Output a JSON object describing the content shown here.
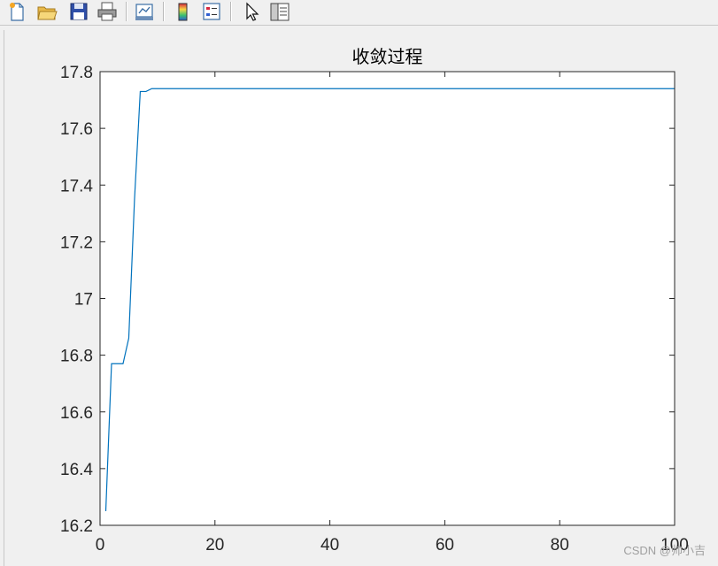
{
  "toolbar": {
    "buttons": [
      {
        "name": "new-figure-icon"
      },
      {
        "name": "open-file-icon"
      },
      {
        "name": "save-figure-icon"
      },
      {
        "name": "print-figure-icon"
      },
      {
        "name": "link-plot-icon"
      },
      {
        "name": "insert-colorbar-icon"
      },
      {
        "name": "insert-legend-icon"
      },
      {
        "name": "edit-plot-cursor-icon"
      },
      {
        "name": "property-inspector-icon"
      }
    ]
  },
  "colors": {
    "line": "#0072bd",
    "axes_background": "#ffffff",
    "figure_background": "#f0f0f0",
    "axis": "#262626"
  },
  "watermark": "CSDN @帅小吉",
  "chart_data": {
    "type": "line",
    "title": "收敛过程",
    "xlabel": "",
    "ylabel": "",
    "xlim": [
      0,
      100
    ],
    "ylim": [
      16.2,
      17.8
    ],
    "xticks": [
      0,
      20,
      40,
      60,
      80,
      100
    ],
    "xtick_labels": [
      "0",
      "20",
      "40",
      "60",
      "80",
      "100"
    ],
    "yticks": [
      16.2,
      16.4,
      16.6,
      16.8,
      17.0,
      17.2,
      17.4,
      17.6,
      17.8
    ],
    "ytick_labels": [
      "16.2",
      "16.4",
      "16.6",
      "16.8",
      "17",
      "17.2",
      "17.4",
      "17.6",
      "17.8"
    ],
    "grid": false,
    "box": true,
    "series": [
      {
        "x": [
          1,
          2,
          3,
          4,
          5,
          6,
          7,
          8,
          9,
          10,
          11,
          12,
          13,
          14,
          15,
          16,
          17,
          18,
          19,
          20,
          21,
          22,
          23,
          24,
          25,
          26,
          27,
          28,
          29,
          30,
          31,
          32,
          33,
          34,
          35,
          36,
          37,
          38,
          39,
          40,
          41,
          42,
          43,
          44,
          45,
          46,
          47,
          48,
          49,
          50,
          51,
          52,
          53,
          54,
          55,
          56,
          57,
          58,
          59,
          60,
          61,
          62,
          63,
          64,
          65,
          66,
          67,
          68,
          69,
          70,
          71,
          72,
          73,
          74,
          75,
          76,
          77,
          78,
          79,
          80,
          81,
          82,
          83,
          84,
          85,
          86,
          87,
          88,
          89,
          90,
          91,
          92,
          93,
          94,
          95,
          96,
          97,
          98,
          99,
          100
        ],
        "values": [
          16.25,
          16.77,
          16.77,
          16.77,
          16.86,
          17.35,
          17.73,
          17.73,
          17.74,
          17.74,
          17.74,
          17.74,
          17.74,
          17.74,
          17.74,
          17.74,
          17.74,
          17.74,
          17.74,
          17.74,
          17.74,
          17.74,
          17.74,
          17.74,
          17.74,
          17.74,
          17.74,
          17.74,
          17.74,
          17.74,
          17.74,
          17.74,
          17.74,
          17.74,
          17.74,
          17.74,
          17.74,
          17.74,
          17.74,
          17.74,
          17.74,
          17.74,
          17.74,
          17.74,
          17.74,
          17.74,
          17.74,
          17.74,
          17.74,
          17.74,
          17.74,
          17.74,
          17.74,
          17.74,
          17.74,
          17.74,
          17.74,
          17.74,
          17.74,
          17.74,
          17.74,
          17.74,
          17.74,
          17.74,
          17.74,
          17.74,
          17.74,
          17.74,
          17.74,
          17.74,
          17.74,
          17.74,
          17.74,
          17.74,
          17.74,
          17.74,
          17.74,
          17.74,
          17.74,
          17.74,
          17.74,
          17.74,
          17.74,
          17.74,
          17.74,
          17.74,
          17.74,
          17.74,
          17.74,
          17.74,
          17.74,
          17.74,
          17.74,
          17.74,
          17.74,
          17.74,
          17.74,
          17.74,
          17.74,
          17.74
        ]
      }
    ]
  }
}
